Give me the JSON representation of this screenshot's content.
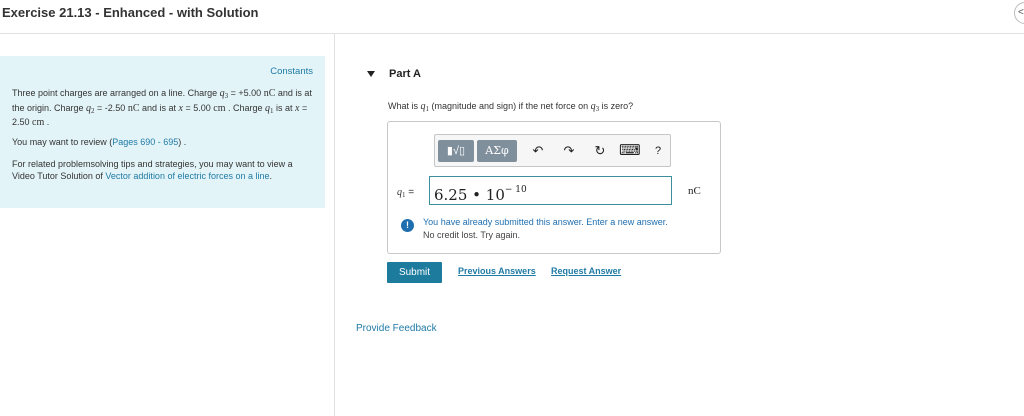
{
  "header": {
    "title": "Exercise 21.13 - Enhanced - with Solution",
    "corner_button_label": "<"
  },
  "problem": {
    "constants_label": "Constants",
    "intro": {
      "t1": "Three point charges are arranged on a line. Charge ",
      "q3_sym": "q",
      "q3_sub": "3",
      "t2": " = +5.00",
      "unit_nC_1": "nC",
      "t3": " and is at the origin. Charge ",
      "q2_sym": "q",
      "q2_sub": "2",
      "t4": " = -2.50 ",
      "unit_nC_2": "nC",
      "t5": " and is at ",
      "x_sym_1": "x",
      "t6": " = 5.00",
      "unit_cm_1": "cm",
      "t7": " . Charge ",
      "q1_sym": "q",
      "q1_sub": "1",
      "t8": " is at ",
      "x_sym_2": "x",
      "t9": " = 2.50 ",
      "unit_cm_2": "cm",
      "t10": " ."
    },
    "review": {
      "prefix": "You may want to review (",
      "link": "Pages 690 - 695",
      "suffix": ") ."
    },
    "related": {
      "prefix": "For related problemsolving tips and strategies, you may want to view a Video Tutor Solution of ",
      "link": "Vector addition of electric forces on a line",
      "suffix": "."
    }
  },
  "part": {
    "label": "Part A",
    "question": {
      "t1": "What is ",
      "q1_sym": "q",
      "q1_sub": "1",
      "t2": " (magnitude and sign) if the net force on ",
      "q3_sym": "q",
      "q3_sub": "3",
      "t3": " is zero?"
    }
  },
  "toolbar": {
    "template_button": "▮√▯",
    "greek_button": "ΑΣφ",
    "undo_icon": "↶",
    "redo_icon": "↷",
    "reset_icon": "↻",
    "keyboard_icon": "⌨",
    "help_icon": "?"
  },
  "answer": {
    "variable_sym": "q",
    "variable_sub": "1",
    "equals": "=",
    "mantissa": "6.25 • 10",
    "exponent": "− 10",
    "unit": "nC"
  },
  "feedback_alert": {
    "icon": "!",
    "title": "You have already submitted this answer. Enter a new answer.",
    "subtitle": "No credit lost. Try again."
  },
  "actions": {
    "submit": "Submit",
    "previous_answers": "Previous Answers",
    "request_answer": "Request Answer"
  },
  "provide_feedback": "Provide Feedback",
  "colors": {
    "accent": "#1d7b9e",
    "link": "#1f7aa6",
    "panel_bg": "#e3f4f8",
    "alert_blue": "#1f6fb0"
  }
}
